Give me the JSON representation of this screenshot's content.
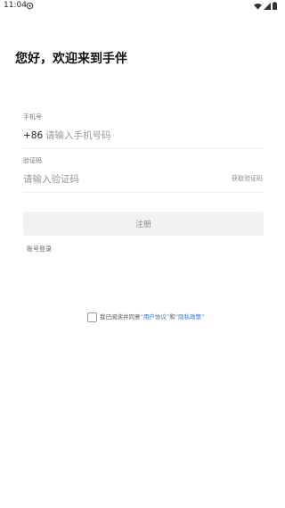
{
  "status_bar": {
    "time": "11:04",
    "icons": [
      "notification-icon",
      "wifi-icon",
      "signal-icon",
      "battery-icon"
    ]
  },
  "welcome": {
    "title": "您好，欢迎来到手伴"
  },
  "phone": {
    "label": "手机号",
    "country_code": "+86",
    "placeholder": "请输入手机号码",
    "value": ""
  },
  "code": {
    "label": "验证码",
    "placeholder": "请输入验证码",
    "value": "",
    "get_code_label": "获取验证码"
  },
  "register_button": {
    "label": "注册"
  },
  "account_login": {
    "label": "账号登录"
  },
  "agreement": {
    "checked": false,
    "prefix": "我已阅读并同意",
    "user_agreement": "“用户协议”",
    "conjunction": "和",
    "privacy_policy": "“隐私政策”"
  },
  "colors": {
    "link": "#2f6fd6",
    "button_bg": "#f2f2f2",
    "button_text": "#8a8a8a",
    "divider": "#eeeeee"
  }
}
